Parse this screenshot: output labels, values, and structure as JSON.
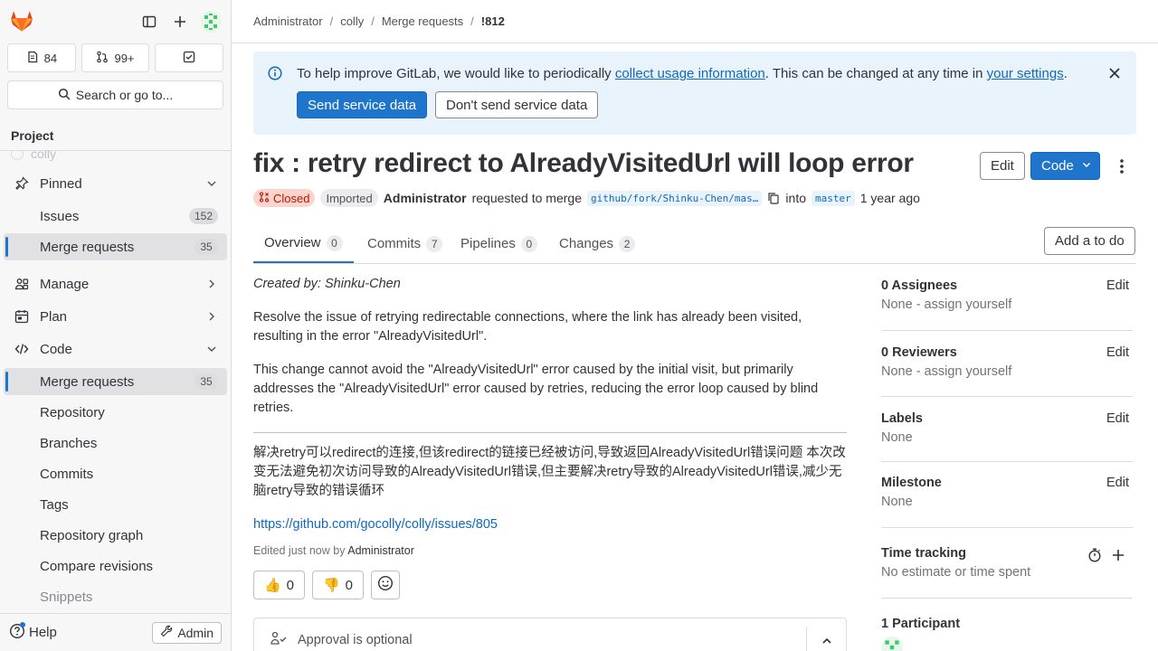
{
  "sidebar": {
    "counts": {
      "issues": "84",
      "merge_requests": "99+"
    },
    "search_label": "Search or go to...",
    "section_title": "Project",
    "faded_item": "colly",
    "items": [
      {
        "label": "Pinned"
      },
      {
        "label": "Issues",
        "count": "152"
      },
      {
        "label": "Merge requests",
        "count": "35"
      },
      {
        "label": "Manage"
      },
      {
        "label": "Plan"
      },
      {
        "label": "Code"
      },
      {
        "label": "Merge requests",
        "count": "35"
      },
      {
        "label": "Repository"
      },
      {
        "label": "Branches"
      },
      {
        "label": "Commits"
      },
      {
        "label": "Tags"
      },
      {
        "label": "Repository graph"
      },
      {
        "label": "Compare revisions"
      },
      {
        "label": "Snippets"
      }
    ],
    "help_label": "Help",
    "admin_label": "Admin"
  },
  "breadcrumb": [
    "Administrator",
    "colly",
    "Merge requests",
    "!812"
  ],
  "banner": {
    "text_before": "To help improve GitLab, we would like to periodically ",
    "link1": "collect usage information",
    "text_middle": ". This can be changed at any time in ",
    "link2": "your settings",
    "text_after": ".",
    "send_label": "Send service data",
    "dont_send_label": "Don't send service data"
  },
  "mr": {
    "title": "fix : retry redirect to AlreadyVisitedUrl will loop error",
    "edit_label": "Edit",
    "code_label": "Code",
    "status": "Closed",
    "imported": "Imported",
    "author": "Administrator",
    "requested_text": "requested to merge",
    "source_branch": "github/fork/Shinku-Chen/mas…",
    "into_text": "into",
    "target_branch": "master",
    "time_ago": "1 year ago"
  },
  "tabs": [
    {
      "label": "Overview",
      "count": "0"
    },
    {
      "label": "Commits",
      "count": "7"
    },
    {
      "label": "Pipelines",
      "count": "0"
    },
    {
      "label": "Changes",
      "count": "2"
    }
  ],
  "todo_label": "Add a to do",
  "description": {
    "created_by": "Created by: Shinku-Chen",
    "p1": "Resolve the issue of retrying redirectable connections, where the link has already been visited, resulting in the error \"AlreadyVisitedUrl\".",
    "p2": "This change cannot avoid the \"AlreadyVisitedUrl\" error caused by the initial visit, but primarily addresses the \"AlreadyVisitedUrl\" error caused by retries, reducing the error loop caused by blind retries.",
    "p3": "解决retry可以redirect的连接,但该redirect的链接已经被访问,导致返回AlreadyVisitedUrl错误问题 本次改变无法避免初次访问导致的AlreadyVisitedUrl错误,但主要解决retry导致的AlreadyVisitedUrl错误,减少无脑retry导致的错误循环",
    "link": "https://github.com/gocolly/colly/issues/805",
    "edited_text": "Edited just now by ",
    "edited_by": "Administrator"
  },
  "reactions": {
    "thumbs_up": "0",
    "thumbs_down": "0"
  },
  "approval_text": "Approval is optional",
  "right_sidebar": {
    "assignees_title": "0 Assignees",
    "assignees_value": "None - assign yourself",
    "reviewers_title": "0 Reviewers",
    "reviewers_value": "None - assign yourself",
    "labels_title": "Labels",
    "labels_value": "None",
    "milestone_title": "Milestone",
    "milestone_value": "None",
    "time_title": "Time tracking",
    "time_value": "No estimate or time spent",
    "participants_title": "1 Participant",
    "edit_label": "Edit"
  },
  "colors": {
    "accent": "#1f75cb",
    "closed_bg": "#fdd4cd",
    "closed_text": "#ae1800",
    "banner_bg": "#e9f3fc"
  }
}
